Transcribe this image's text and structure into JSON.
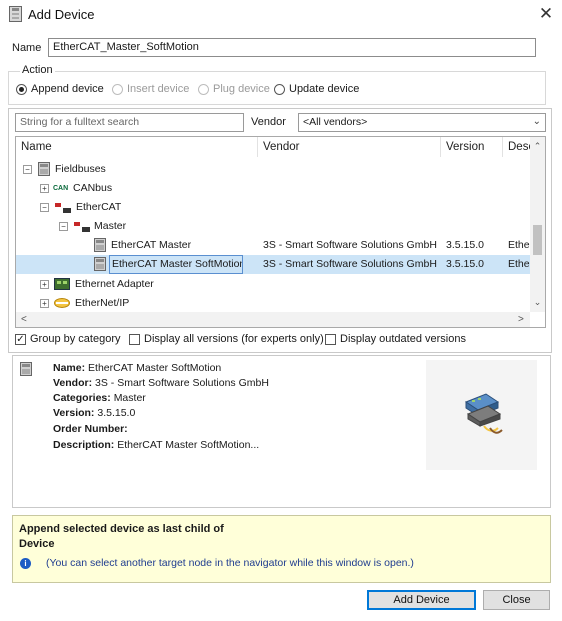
{
  "window": {
    "title": "Add Device",
    "close_glyph": "✕"
  },
  "name_field": {
    "label": "Name",
    "value": "EtherCAT_Master_SoftMotion"
  },
  "action": {
    "legend": "Action",
    "options": [
      {
        "label": "Append device",
        "selected": true,
        "enabled": true
      },
      {
        "label": "Insert device",
        "selected": false,
        "enabled": false
      },
      {
        "label": "Plug device",
        "selected": false,
        "enabled": false
      },
      {
        "label": "Update device",
        "selected": false,
        "enabled": true
      }
    ]
  },
  "search": {
    "placeholder": "String for a fulltext search"
  },
  "vendor_filter": {
    "label": "Vendor",
    "selected": "<All vendors>"
  },
  "tree": {
    "columns": [
      "Name",
      "Vendor",
      "Version",
      "Desc"
    ],
    "rows": [
      {
        "name": "Fieldbuses",
        "vendor": "",
        "version": "",
        "desc": "",
        "expander": "−",
        "icon": "fieldbus-icon",
        "prefix": "",
        "selected": false
      },
      {
        "name": "CANbus",
        "vendor": "",
        "version": "",
        "desc": "",
        "expander": "+",
        "icon": "canbus-icon",
        "prefix": "CAN",
        "selected": false
      },
      {
        "name": "EtherCAT",
        "vendor": "",
        "version": "",
        "desc": "",
        "expander": "−",
        "icon": "ethercat-icon",
        "prefix": "",
        "selected": false
      },
      {
        "name": "Master",
        "vendor": "",
        "version": "",
        "desc": "",
        "expander": "−",
        "icon": "ethercat-icon",
        "prefix": "",
        "selected": false
      },
      {
        "name": "EtherCAT Master",
        "vendor": "3S - Smart Software Solutions GmbH",
        "version": "3.5.15.0",
        "desc": "Ether",
        "expander": "",
        "icon": "device-icon",
        "prefix": "",
        "selected": false
      },
      {
        "name": "EtherCAT Master SoftMotion",
        "vendor": "3S - Smart Software Solutions GmbH",
        "version": "3.5.15.0",
        "desc": "Ether",
        "expander": "",
        "icon": "device-icon",
        "prefix": "",
        "selected": true
      },
      {
        "name": "Ethernet Adapter",
        "vendor": "",
        "version": "",
        "desc": "",
        "expander": "+",
        "icon": "ethernet-adapter-icon",
        "prefix": "",
        "selected": false
      },
      {
        "name": "EtherNet/IP",
        "vendor": "",
        "version": "",
        "desc": "",
        "expander": "+",
        "icon": "ethernet-ip-icon",
        "prefix": "",
        "selected": false
      }
    ]
  },
  "options": {
    "group_by_category": {
      "label": "Group by category",
      "checked": true
    },
    "display_all_versions": {
      "label": "Display all versions (for experts only)",
      "checked": false
    },
    "display_outdated": {
      "label": "Display outdated versions",
      "checked": false
    }
  },
  "info": {
    "name": {
      "key": "Name:",
      "value": "EtherCAT Master SoftMotion"
    },
    "vendor": {
      "key": "Vendor:",
      "value": "3S - Smart Software Solutions GmbH"
    },
    "categories": {
      "key": "Categories:",
      "value": "Master"
    },
    "version": {
      "key": "Version:",
      "value": "3.5.15.0"
    },
    "order_number": {
      "key": "Order Number:",
      "value": ""
    },
    "description": {
      "key": "Description:",
      "value": "EtherCAT Master SoftMotion..."
    }
  },
  "hint": {
    "title_line1": "Append selected device as last child of",
    "title_line2": "Device",
    "note": "(You can select another target node in the navigator while this window is open.)"
  },
  "buttons": {
    "add": "Add Device",
    "close": "Close"
  },
  "colors": {
    "selection": "#cce4f7",
    "hint_background": "#ffffd9",
    "accent": "#0078d7"
  }
}
